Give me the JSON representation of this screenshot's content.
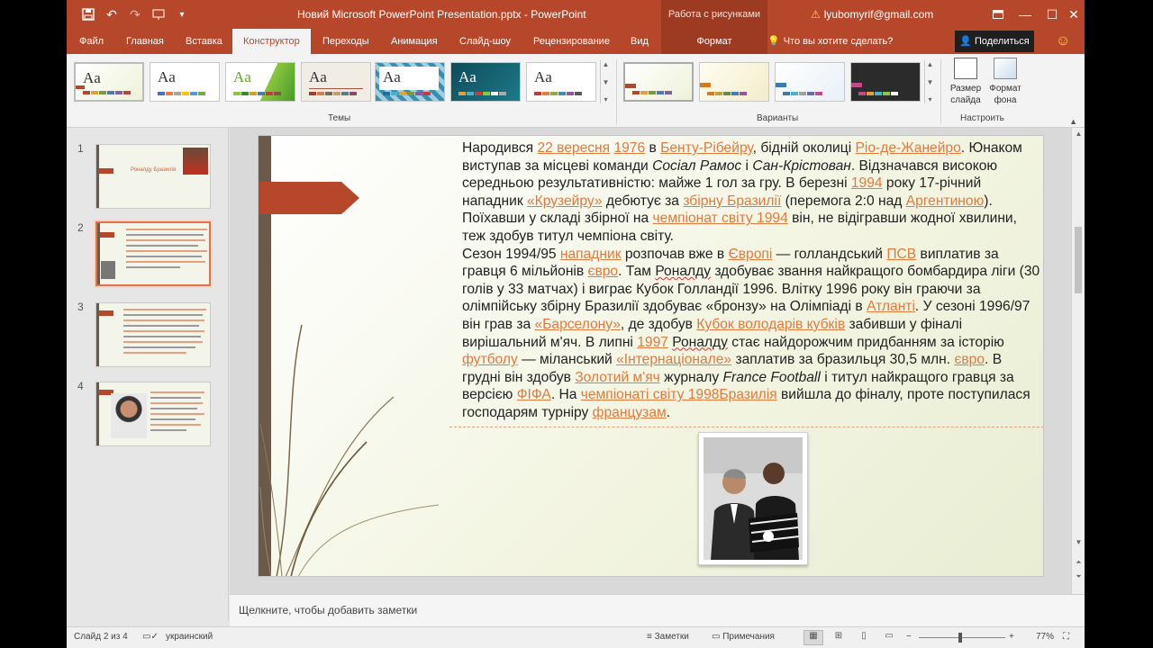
{
  "titlebar": {
    "title": "Новий Microsoft PowerPoint Presentation.pptx  -  PowerPoint",
    "contextual": "Работа с рисунками",
    "account": "lyubomyrif@gmail.com",
    "qat_icons": [
      "save-icon",
      "undo-icon",
      "redo-icon",
      "present-icon",
      "customize-icon"
    ]
  },
  "tabs": {
    "file": "Файл",
    "home": "Главная",
    "insert": "Вставка",
    "design": "Конструктор",
    "transitions": "Переходы",
    "animation": "Анимация",
    "slideshow": "Слайд-шоу",
    "review": "Рецензирование",
    "view": "Вид",
    "format": "Формат",
    "tell_me": "Что вы хотите сделать?",
    "share": "Поделиться"
  },
  "ribbon": {
    "themes_label": "Темы",
    "variants_label": "Варианты",
    "customize_label": "Настроить",
    "theme_glyph": "Aa",
    "slide_size": "Размер слайда",
    "format_bg": "Формат фона"
  },
  "thumbnails": [
    {
      "num": "1",
      "title": "Роналду Бразилія"
    },
    {
      "num": "2"
    },
    {
      "num": "3"
    },
    {
      "num": "4"
    }
  ],
  "slide": {
    "p1": {
      "a": "Народився ",
      "l1": "22 вересня",
      "b": " ",
      "l2": "1976",
      "c": " в ",
      "l3": "Бенту-Рібейру",
      "d": ", бідній околиці ",
      "l4": "Ріо-де-Жанейро",
      "e": ".",
      "f": " Юнаком виступав за місцеві команди ",
      "i1": "Сосіал Рамос",
      "g": " і ",
      "i2": "Сан-Крістован",
      "h": ". Відзначався високою середньою результативністю: майже 1 гол за гру. В березні ",
      "l5": "1994",
      "j": " року 17-річний нападник ",
      "l6": "«Крузейру»",
      "k": " дебютує за ",
      "l7": "збірну Бразилії",
      "m": " (перемога 2:0 над ",
      "l8": "Аргентиною",
      "n": "). Поїхавши у складі збірної на ",
      "l9": "чемпіонат світу 1994",
      "o": " він, не відігравши жодної хвилини, теж здобув титул чемпіона світу."
    },
    "p2": {
      "a": "Сезон 1994/95 ",
      "l1": "нападник",
      "b": " розпочав вже в ",
      "l2": "Європі",
      "c": " — голландський ",
      "l3": "ПСВ",
      "d": " виплатив за гравця 6 мільйонів ",
      "l4": "євро",
      "e": ". Там ",
      "s1": "Роналду",
      "f": " здобуває звання найкращого бомбардира ліги (30 голів у 33 матчах) і виграє Кубок Голландії 1996. Влітку 1996 року він граючи за олімпійську збірну Бразилії здобуває «бронзу» на Олімпіаді в ",
      "l5": "Атланті",
      "g": ". У сезоні 1996/97 він грав за ",
      "l6": "«Барселону»",
      "h": ", де здобув ",
      "l7": "Кубок володарів кубків",
      "j": " забивши у фіналі вирішальний м'яч. В липні ",
      "l8": "1997",
      "k": " ",
      "s2": "Роналду",
      "m": " стає найдорожчим придбанням за історію ",
      "l9": "футболу",
      "n": " — міланський ",
      "l10": "«Інтернаціонале»",
      "o": " заплатив за бразильця 30,5 млн. ",
      "l11": "євро",
      "q": ". В грудні він здобув ",
      "l12": "Золотий м'яч",
      "r": " журналу ",
      "i1": "France Football",
      "t": " і титул найкращого гравця за версією ",
      "l13": "ФІФА",
      "u": ". На ",
      "l14": "чемпіонаті світу 1998Бразилія",
      "v": " вийшла до фіналу, проте поступилася господарям турніру ",
      "l15": "французам",
      "w": "."
    }
  },
  "notes": {
    "placeholder": "Щелкните, чтобы добавить заметки"
  },
  "status": {
    "slide_info": "Слайд 2 из 4",
    "language": "украинский",
    "notes": "Заметки",
    "comments": "Примечания",
    "zoom": "77%"
  },
  "colors": {
    "accent": "#b7472a",
    "contextual": "#9c3b22",
    "link": "#e07a3f"
  }
}
